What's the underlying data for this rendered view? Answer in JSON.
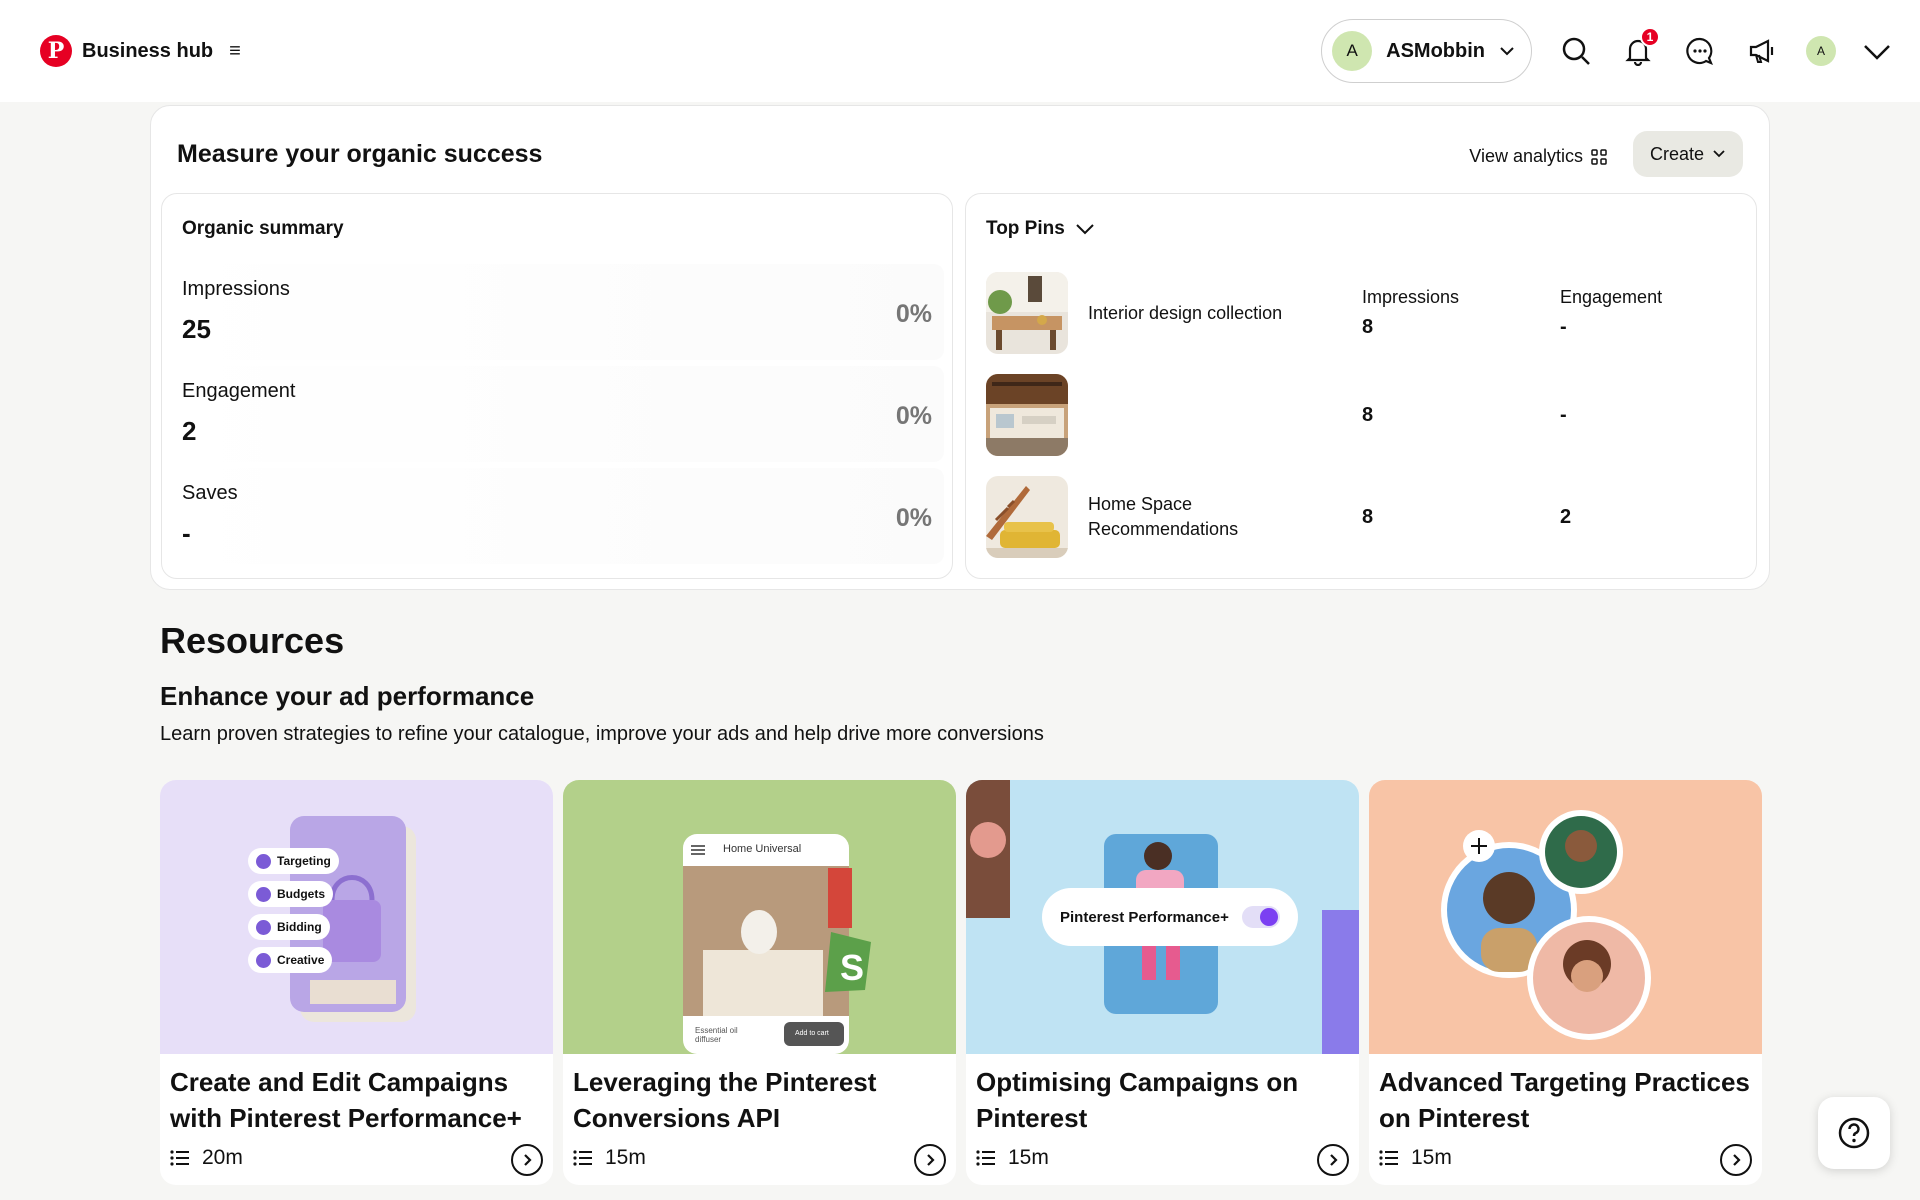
{
  "header": {
    "brand": "Business hub",
    "account_initial": "A",
    "account_name": "ASMobbin",
    "notification_count": "1",
    "avatar_initial": "A"
  },
  "measure": {
    "title": "Measure your organic success",
    "view_analytics": "View analytics",
    "create": "Create"
  },
  "organic": {
    "title": "Organic summary",
    "metrics": [
      {
        "label": "Impressions",
        "value": "25",
        "pct": "0%"
      },
      {
        "label": "Engagement",
        "value": "2",
        "pct": "0%"
      },
      {
        "label": "Saves",
        "value": "-",
        "pct": "0%"
      }
    ]
  },
  "top_pins": {
    "title": "Top Pins",
    "impressions_header": "Impressions",
    "engagement_header": "Engagement",
    "rows": [
      {
        "name": "Interior design collection",
        "impressions": "8",
        "engagement": "-"
      },
      {
        "name": "",
        "impressions": "8",
        "engagement": "-"
      },
      {
        "name": "Home Space Recommendations",
        "impressions": "8",
        "engagement": "2"
      }
    ]
  },
  "resources": {
    "title": "Resources",
    "subtitle": "Enhance your ad performance",
    "description": "Learn proven strategies to refine your catalogue, improve your ads and help drive more conversions",
    "cards": [
      {
        "title": "Create and Edit Campaigns with Pinterest Performance+",
        "duration": "20m",
        "bg": "#e7dff8"
      },
      {
        "title": "Leveraging the Pinterest Conversions API",
        "duration": "15m",
        "bg": "#b3d08a"
      },
      {
        "title": "Optimising Campaigns on Pinterest",
        "duration": "15m",
        "bg": "#bfe3f3"
      },
      {
        "title": "Advanced Targeting Practices on Pinterest",
        "duration": "15m",
        "bg": "#f8c4a6"
      }
    ],
    "card1_pills": [
      "Targeting",
      "Budgets",
      "Bidding",
      "Creative"
    ],
    "card2_app_title": "Home Universal",
    "card2_caption": "Essential oil diffuser",
    "card2_button": "Add to cart",
    "card3_toggle_label": "Pinterest Performance+"
  },
  "colors": {
    "brand_red": "#e60023",
    "accent_purple": "#7b3ff2"
  }
}
